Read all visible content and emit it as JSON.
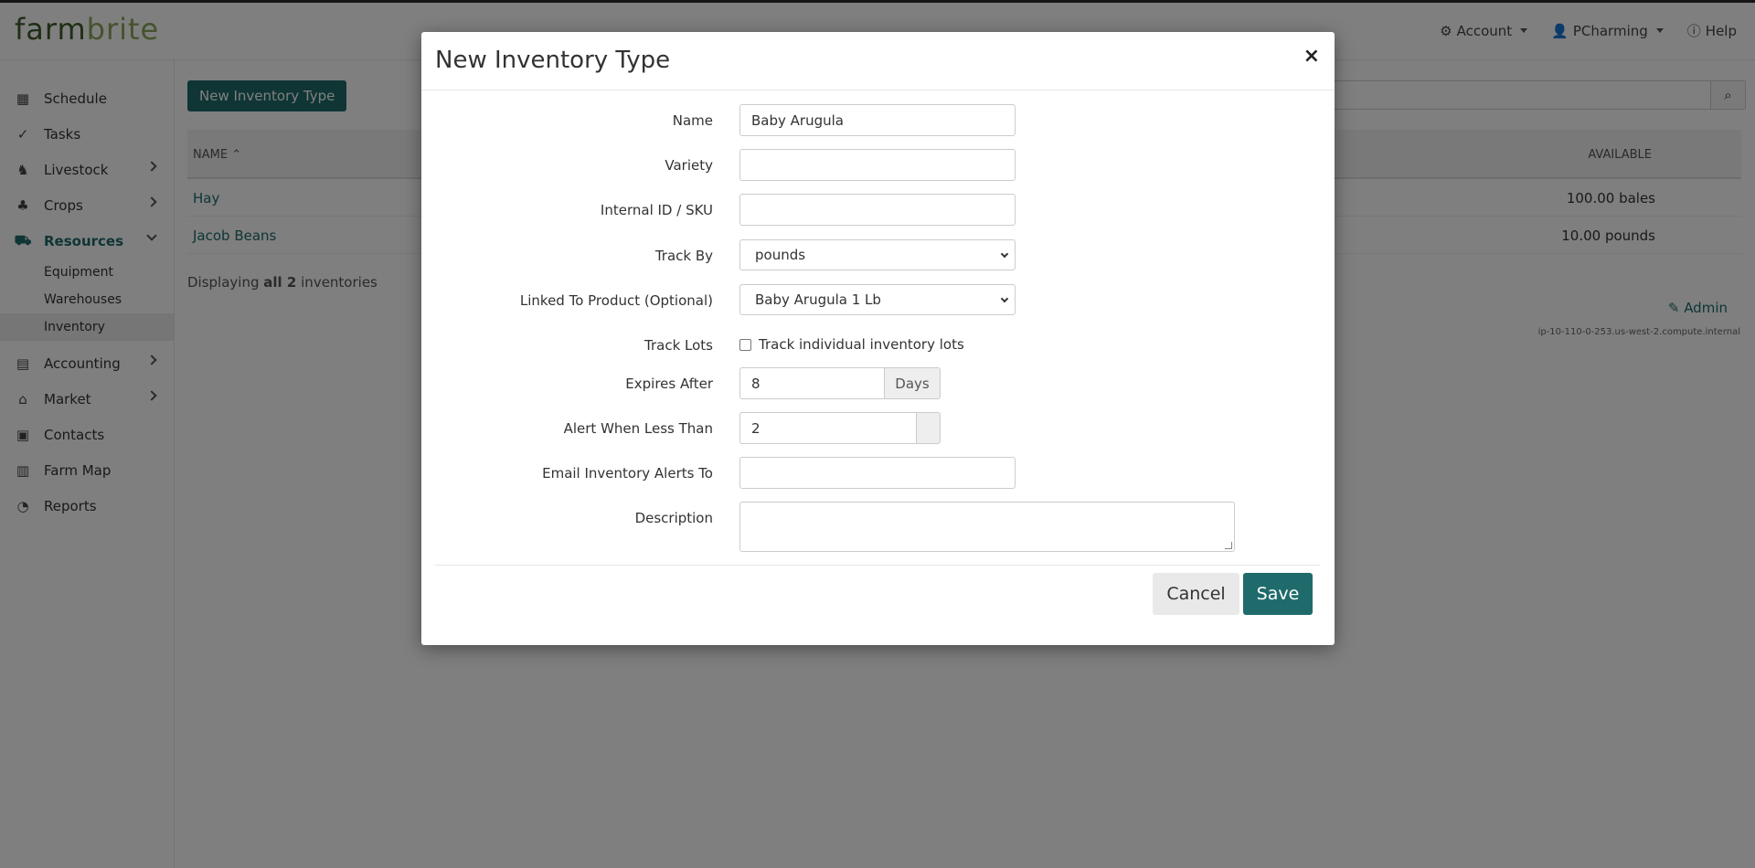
{
  "brand": {
    "part1": "farm",
    "part2": "brite"
  },
  "topnav": {
    "account": "Account",
    "user": "PCharming",
    "help": "Help"
  },
  "sidebar": {
    "items": [
      {
        "label": "Schedule",
        "icon": "calendar-icon"
      },
      {
        "label": "Tasks",
        "icon": "check-circle-icon"
      },
      {
        "label": "Livestock",
        "icon": "horse-icon"
      },
      {
        "label": "Crops",
        "icon": "seedling-icon"
      },
      {
        "label": "Resources",
        "icon": "tractor-icon"
      },
      {
        "label": "Accounting",
        "icon": "calculator-icon"
      },
      {
        "label": "Market",
        "icon": "store-icon"
      },
      {
        "label": "Contacts",
        "icon": "address-book-icon"
      },
      {
        "label": "Farm Map",
        "icon": "map-icon"
      },
      {
        "label": "Reports",
        "icon": "pie-chart-icon"
      }
    ],
    "resources_sub": [
      "Equipment",
      "Warehouses",
      "Inventory"
    ]
  },
  "main": {
    "new_button": "New Inventory Type",
    "columns": {
      "name": "NAME",
      "available": "AVAILABLE"
    },
    "rows": [
      {
        "name": "Hay",
        "available": "100.00 bales"
      },
      {
        "name": "Jacob Beans",
        "available": "10.00 pounds"
      }
    ],
    "displaying_prefix": "Displaying",
    "displaying_bold": "all 2",
    "displaying_suffix": "inventories",
    "admin": "Admin",
    "host": "ip-10-110-0-253.us-west-2.compute.internal"
  },
  "modal": {
    "title": "New Inventory Type",
    "close": "×",
    "fields": {
      "name_label": "Name",
      "name_value": "Baby Arugula",
      "variety_label": "Variety",
      "variety_value": "",
      "sku_label": "Internal ID / SKU",
      "sku_value": "",
      "track_by_label": "Track By",
      "track_by_value": "pounds",
      "linked_label": "Linked To Product (Optional)",
      "linked_value": "Baby Arugula 1 Lb",
      "track_lots_label": "Track Lots",
      "track_lots_text": "Track individual inventory lots",
      "track_lots_checked": false,
      "expires_label": "Expires After",
      "expires_value": "8",
      "expires_unit": "Days",
      "alert_label": "Alert When Less Than",
      "alert_value": "2",
      "alert_unit": "",
      "email_label": "Email Inventory Alerts To",
      "email_value": "",
      "description_label": "Description",
      "description_value": ""
    },
    "cancel": "Cancel",
    "save": "Save"
  }
}
